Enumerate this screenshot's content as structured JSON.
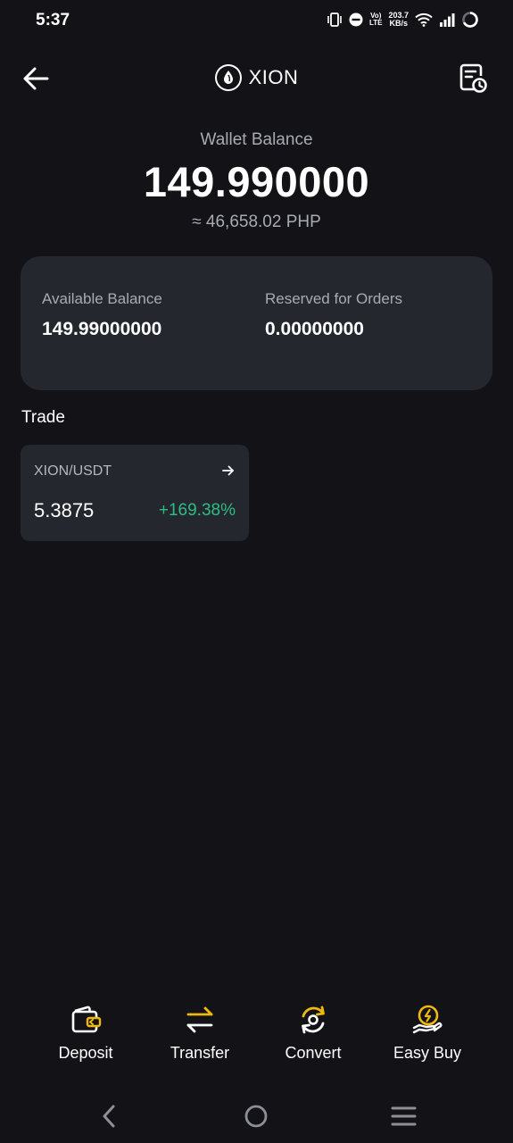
{
  "status_bar": {
    "time": "5:37",
    "volte_top": "Vo)",
    "volte_bottom": "LTE",
    "net_speed_value": "203.7",
    "net_speed_unit": "KB/s"
  },
  "header": {
    "title": "XION"
  },
  "wallet": {
    "label": "Wallet Balance",
    "value": "149.990000",
    "fiat": "≈ 46,658.02 PHP"
  },
  "balance_card": {
    "available_label": "Available Balance",
    "available_value": "149.99000000",
    "reserved_label": "Reserved for Orders",
    "reserved_value": "0.00000000"
  },
  "trade": {
    "title": "Trade",
    "pair": "XION/USDT",
    "price": "5.3875",
    "change": "+169.38%"
  },
  "actions": {
    "deposit": "Deposit",
    "transfer": "Transfer",
    "convert": "Convert",
    "easy_buy": "Easy Buy"
  },
  "colors": {
    "background": "#121217",
    "card": "#24272d",
    "accent": "#f0b90b",
    "positive": "#2ebd85",
    "muted_text": "#a9abb1"
  },
  "icons": [
    "back-arrow-icon",
    "xion-logo-icon",
    "history-icon",
    "arrow-right-icon",
    "deposit-icon",
    "transfer-icon",
    "convert-icon",
    "easy-buy-icon",
    "nav-back-icon",
    "nav-home-icon",
    "nav-menu-icon"
  ]
}
